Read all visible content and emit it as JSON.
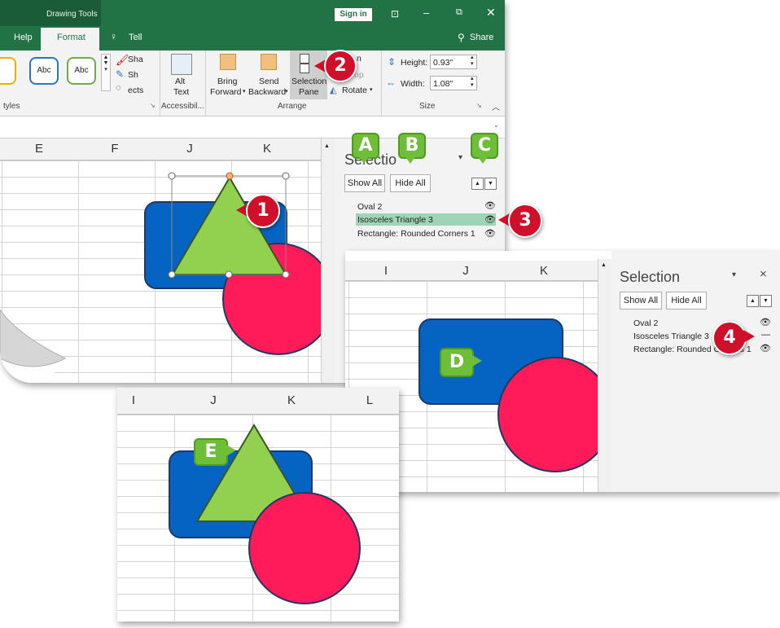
{
  "titlebar": {
    "context_label": "Drawing Tools",
    "signin_label": "Sign in"
  },
  "ribbon": {
    "tab_help": "Help",
    "tab_format": "Format",
    "tab_tell": "Tell",
    "share_label": "Share",
    "shape_style_1": "Abc",
    "shape_style_2": "Abc",
    "shape_fill": "Sha",
    "shape_outline": "Sh",
    "shape_effects": "ects",
    "group_styles": "tyles",
    "alt_text_1": "Alt",
    "alt_text_2": "Text",
    "group_accessibility": "Accessibil...",
    "bring_forward_1": "Bring",
    "bring_forward_2": "Forward",
    "send_backward_1": "Send",
    "send_backward_2": "Backward",
    "selection_pane_1": "Selection",
    "selection_pane_2": "Pane",
    "align_frag": "n",
    "group_frag": "up",
    "rotate": "Rotate",
    "group_arrange": "Arrange",
    "height_label": "Height:",
    "height_value": "0.93\"",
    "width_label": "Width:",
    "width_value": "1.08\"",
    "group_size": "Size"
  },
  "sheet1": {
    "columns": [
      "E",
      "F",
      "J",
      "K"
    ]
  },
  "sheet2": {
    "columns": [
      "I",
      "J",
      "K"
    ]
  },
  "sheet3": {
    "columns": [
      "I",
      "J",
      "K",
      "L"
    ]
  },
  "pane1": {
    "title": "Selectio",
    "show_all": "Show All",
    "hide_all": "Hide All",
    "items": [
      "Oval 2",
      "Isosceles Triangle 3",
      "Rectangle: Rounded Corners 1"
    ]
  },
  "pane2": {
    "title": "Selection",
    "close": "×",
    "show_all": "Show All",
    "hide_all": "Hide All",
    "items": [
      "Oval 2",
      "Isosceles Triangle 3",
      "Rectangle: Rounded Corners 1"
    ]
  },
  "callouts": {
    "a": "A",
    "b": "B",
    "c": "C",
    "d": "D",
    "e": "E",
    "n1": "1",
    "n2": "2",
    "n3": "3",
    "n4": "4"
  },
  "colors": {
    "ribbon_green": "#217346",
    "rect_blue": "#0563c1",
    "triangle_green": "#92d050",
    "oval_red": "#ff1a5a",
    "highlight": "#9fd5b7"
  }
}
